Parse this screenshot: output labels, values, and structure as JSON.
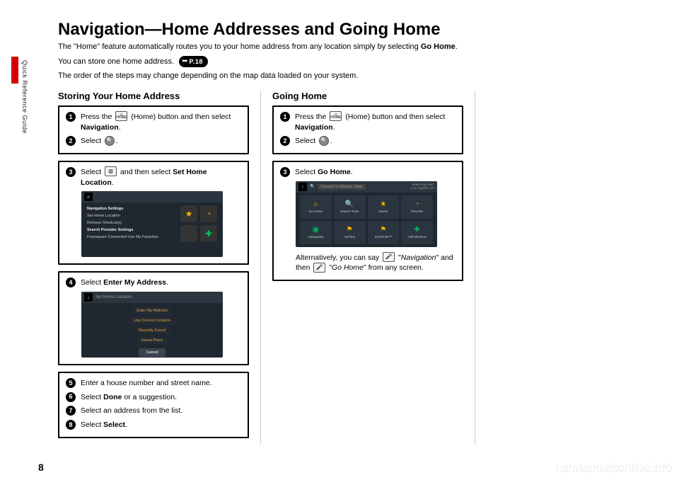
{
  "side_label": "Quick Reference Guide",
  "page_number": "8",
  "title": "Navigation—Home Addresses and Going Home",
  "intro": {
    "line1_pre": "The \"Home\" feature automatically routes you to your home address from any location simply by selecting ",
    "line1_bold": "Go Home",
    "line1_post": ".",
    "line2": "You can store one home address.",
    "pref": "P.18",
    "line3": "The order of the steps may change depending on the map data loaded on your system."
  },
  "col1": {
    "heading": "Storing Your Home Address",
    "steps1": {
      "s1_a": "Press the ",
      "s1_b": " (Home) button and then select ",
      "s1_bold": "Navigation",
      "s1_c": ".",
      "s2_a": "Select ",
      "s2_b": "."
    },
    "steps3": {
      "s3_a": "Select ",
      "s3_b": " and then select ",
      "s3_bold": "Set Home Location",
      "s3_c": "."
    },
    "shot1_menu": {
      "m1": "Navigation Settings",
      "m2": "Set Home Location",
      "m3": "Remove Shortcut(s)",
      "m4h": "Search Provider Settings",
      "m4": "Foursquare Connected   Use My Favorites"
    },
    "steps4": {
      "s4_a": "Select ",
      "s4_bold": "Enter My Address",
      "s4_b": "."
    },
    "shot2_opts": {
      "title": "Set Home Location",
      "o1": "Enter My Address",
      "o2": "Use Current Location",
      "o3": "Recently Found",
      "o4": "Saved Place",
      "cancel": "Cancel"
    },
    "steps5_8": {
      "s5": "Enter a house number and street name.",
      "s6_a": "Select ",
      "s6_bold": "Done",
      "s6_b": " or a suggestion.",
      "s7": "Select an address from the list.",
      "s8_a": "Select ",
      "s8_bold": "Select",
      "s8_b": "."
    }
  },
  "col2": {
    "heading": "Going Home",
    "steps1": {
      "s1_a": "Press the ",
      "s1_b": " (Home) button and then select ",
      "s1_bold": "Navigation",
      "s1_c": ".",
      "s2_a": "Select ",
      "s2_b": "."
    },
    "steps3": {
      "s3_a": "Select ",
      "s3_bold": "Go Home",
      "s3_b": "."
    },
    "shot3_search": "Keyword or Address, State",
    "shot3_near_label": "Searching near:",
    "shot3_near_place": "Los Angeles, CA",
    "shot3_cells": {
      "c1": "Go Home",
      "c2": "Search Tools",
      "c3": "Saved",
      "c4": "Recents",
      "c5": "Categories",
      "c6": "myTrips",
      "c7": "myTrends™",
      "c8": "Add Shortcut"
    },
    "note_a": "Alternatively, you can say ",
    "note_b": " \"",
    "note_nav": "Navigation",
    "note_c": "\" and then ",
    "note_d": " \"",
    "note_go": "Go Home",
    "note_e": "\" from any screen."
  },
  "watermark": "carmanualsonline.info"
}
